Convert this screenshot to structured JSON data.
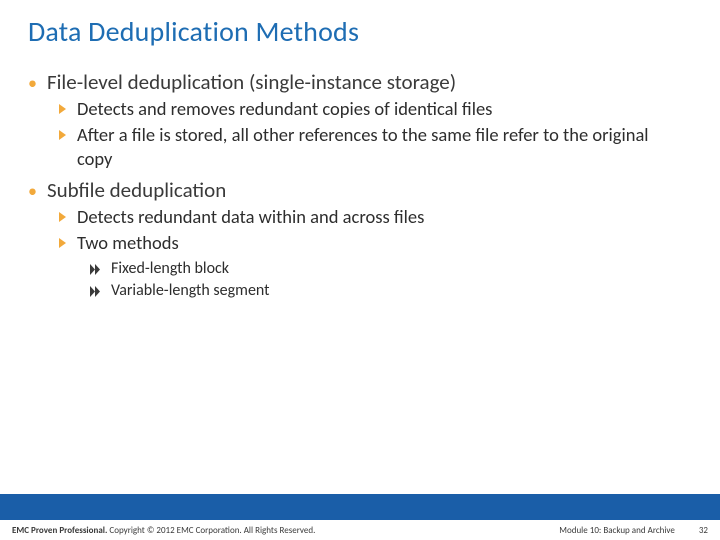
{
  "title": "Data Deduplication Methods",
  "sections": [
    {
      "heading": "File-level deduplication (single-instance storage)",
      "subs": [
        {
          "text": "Detects and removes redundant copies of identical files"
        },
        {
          "text": "After a file is stored, all other references to the same file refer to the original copy"
        }
      ]
    },
    {
      "heading": "Subfile deduplication",
      "subs": [
        {
          "text": "Detects redundant data within and across files"
        },
        {
          "text": "Two methods",
          "subsubs": [
            {
              "text": "Fixed-length block"
            },
            {
              "text": "Variable-length segment"
            }
          ]
        }
      ]
    }
  ],
  "footer": {
    "left_bold": "EMC Proven Professional.",
    "left_rest": " Copyright © 2012 EMC Corporation. All Rights Reserved.",
    "module": "Module 10: Backup and Archive",
    "page": "32"
  }
}
